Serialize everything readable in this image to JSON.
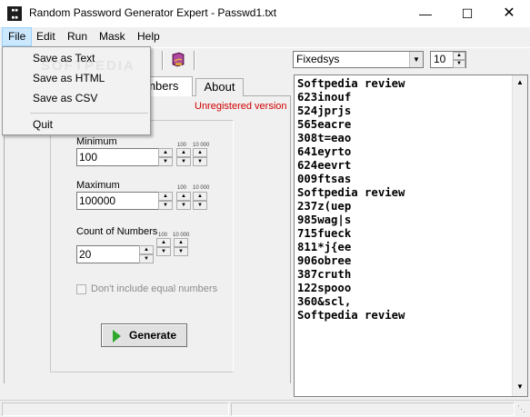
{
  "window": {
    "title": "Random Password Generator Expert - Passwd1.txt",
    "app_icon_text": "PW\nGN"
  },
  "menubar": {
    "items": [
      "File",
      "Edit",
      "Run",
      "Mask",
      "Help"
    ]
  },
  "file_menu": {
    "items": [
      "Save as Text",
      "Save as HTML",
      "Save as CSV"
    ],
    "quit": "Quit",
    "watermark": "SOFTPEDIA"
  },
  "toolbar": {
    "font": "Fixedsys",
    "font_size": "10"
  },
  "tabs": {
    "numbers": "Numbers",
    "numbers_visible": "umbers",
    "about": "About"
  },
  "panel": {
    "unregistered": "Unregistered version",
    "minimum_label": "Minimum",
    "minimum_value": "100",
    "maximum_label": "Maximum",
    "maximum_value": "100000",
    "count_label": "Count of Numbers",
    "count_value": "20",
    "step_100": "100",
    "step_10000": "10 000",
    "checkbox_label": "Don't include equal numbers",
    "checkbox_checked": false,
    "generate": "Generate"
  },
  "output": {
    "lines": [
      "Softpedia review",
      "623inouf",
      "524jprjs",
      "565eacre",
      "308t=eao",
      "641eyrto",
      "624eevrt",
      "009ftsas",
      "Softpedia review",
      "237z(uep",
      "985wag|s",
      "715fueck",
      "811*j{ee",
      "906obree",
      "387cruth",
      "122spooo",
      "360&scl,",
      "Softpedia review"
    ]
  },
  "colors": {
    "unregistered": "#d00000",
    "generate_icon": "#2fa82f",
    "menu_highlight": "#cce8ff"
  }
}
